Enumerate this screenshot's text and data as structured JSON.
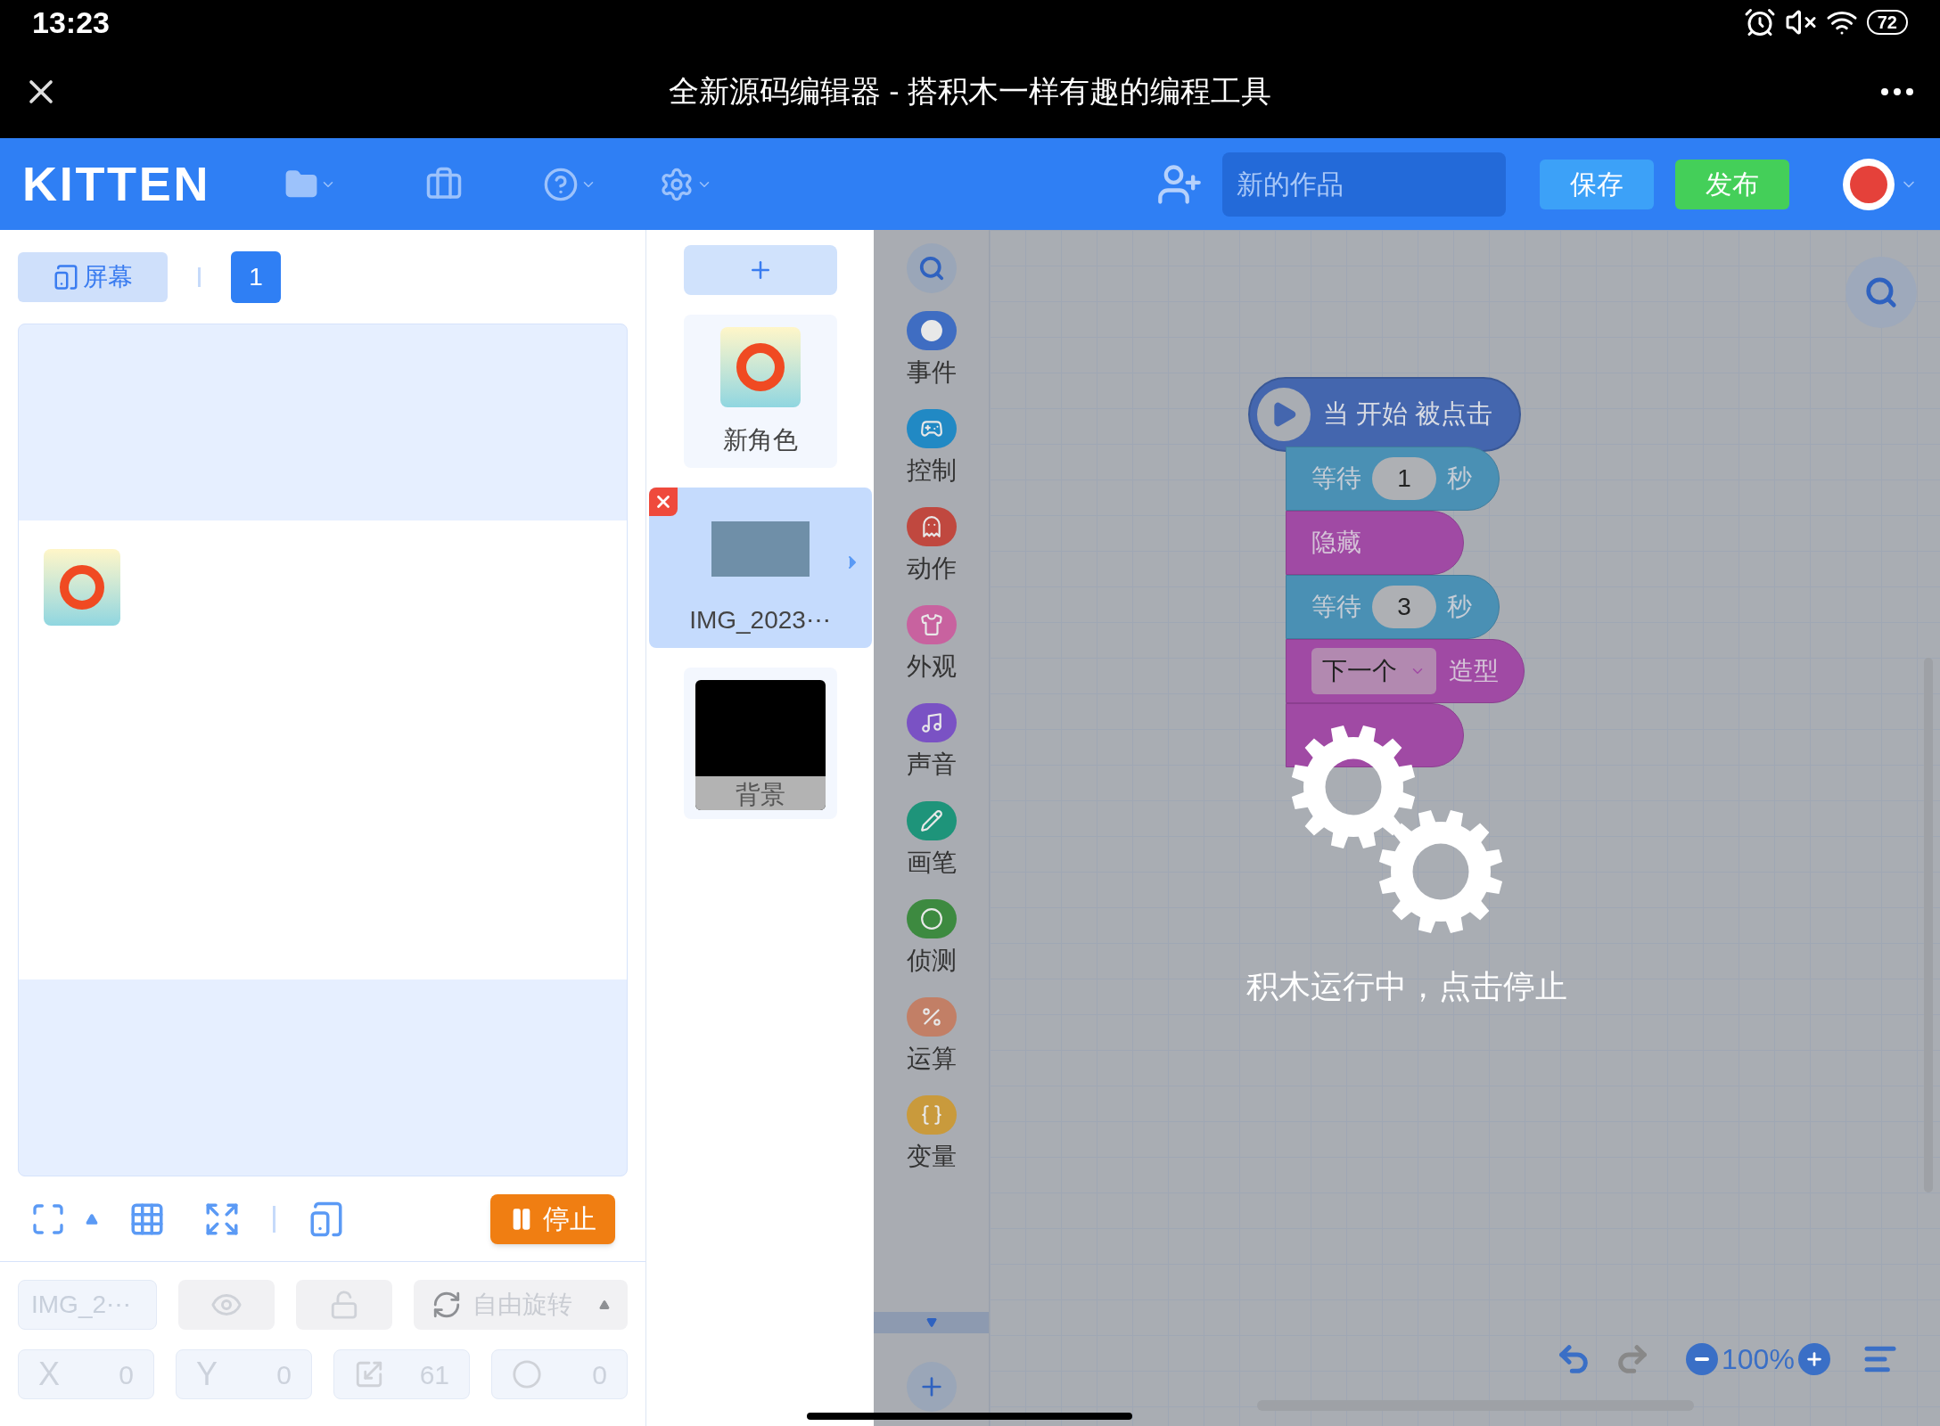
{
  "status_bar": {
    "time": "13:23",
    "battery": "72"
  },
  "title_bar": {
    "title": "全新源码编辑器 - 搭积木一样有趣的编程工具"
  },
  "header": {
    "logo": "KITTEN",
    "project_name": {
      "placeholder": "新的作品"
    },
    "buttons": [
      {
        "label": "保存",
        "kind": "save"
      },
      {
        "label": "发布",
        "kind": "publish"
      }
    ]
  },
  "stage_tabs": {
    "screen_tab": "屏幕",
    "screen_number": "1"
  },
  "stage_toolbar": {
    "stop_button": "停止"
  },
  "sprite_props": {
    "disabled": true,
    "name": "IMG_2⋯",
    "rotation": "自由旋转",
    "fields": [
      {
        "kind": "text",
        "label": "X",
        "value": "0"
      },
      {
        "kind": "text",
        "label": "Y",
        "value": "0"
      },
      {
        "kind": "size",
        "value": "61"
      },
      {
        "kind": "direction",
        "value": "0"
      }
    ]
  },
  "sprites": [
    {
      "kind": "sprite",
      "name": "新角色",
      "selected": false
    },
    {
      "kind": "photo",
      "name": "IMG_2023⋯",
      "selected": true
    },
    {
      "kind": "background",
      "name": "背景",
      "selected": false
    }
  ],
  "categories": [
    {
      "kind": "event",
      "label": "事件",
      "color": "#3f6dc2"
    },
    {
      "kind": "control",
      "label": "控制",
      "color": "#2189c4"
    },
    {
      "kind": "action",
      "label": "动作",
      "color": "#c0483f"
    },
    {
      "kind": "looks",
      "label": "外观",
      "color": "#c8629f"
    },
    {
      "kind": "sound",
      "label": "声音",
      "color": "#7a52c4"
    },
    {
      "kind": "pen",
      "label": "画笔",
      "color": "#1e947a"
    },
    {
      "kind": "sensing",
      "label": "侦测",
      "color": "#3d8a40"
    },
    {
      "kind": "operator",
      "label": "运算",
      "color": "#c27f66"
    },
    {
      "kind": "variable",
      "label": "变量",
      "color": "#c99a3c"
    }
  ],
  "blocks": [
    {
      "kind": "hat",
      "text": "当 开始 被点击"
    },
    {
      "kind": "wait",
      "label": "等待",
      "value": "1",
      "unit": "秒"
    },
    {
      "kind": "looks",
      "label": "隐藏"
    },
    {
      "kind": "wait",
      "label": "等待",
      "value": "3",
      "unit": "秒"
    },
    {
      "kind": "costume",
      "option": "下一个",
      "label": "造型"
    },
    {
      "kind": "looks"
    }
  ],
  "running_overlay": {
    "message": "积木运行中，点击停止"
  },
  "zoom": {
    "value": "100%"
  }
}
